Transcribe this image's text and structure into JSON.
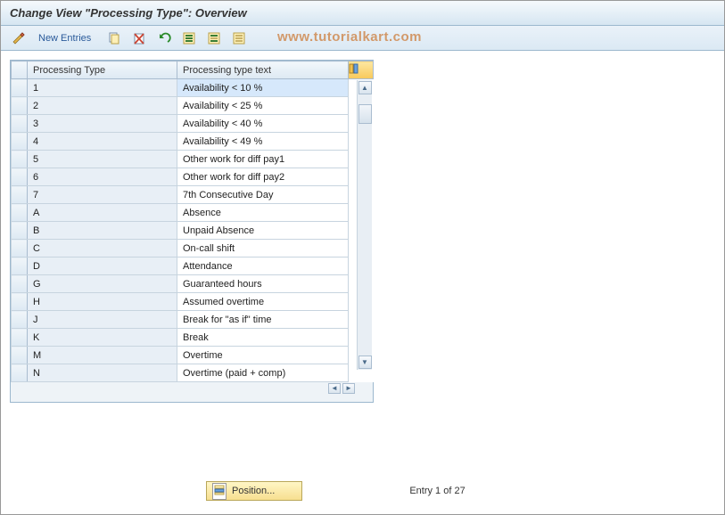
{
  "window": {
    "title": "Change View \"Processing Type\": Overview"
  },
  "toolbar": {
    "new_entries_label": "New Entries"
  },
  "watermark": "www.tutorialkart.com",
  "table": {
    "headers": {
      "type": "Processing Type",
      "text": "Processing type text"
    },
    "rows": [
      {
        "type": "1",
        "text": "Availability < 10 %"
      },
      {
        "type": "2",
        "text": "Availability < 25 %"
      },
      {
        "type": "3",
        "text": "Availability < 40 %"
      },
      {
        "type": "4",
        "text": "Availability < 49 %"
      },
      {
        "type": "5",
        "text": "Other work for diff pay1"
      },
      {
        "type": "6",
        "text": "Other work for diff pay2"
      },
      {
        "type": "7",
        "text": "7th Consecutive Day"
      },
      {
        "type": "A",
        "text": "Absence"
      },
      {
        "type": "B",
        "text": "Unpaid Absence"
      },
      {
        "type": "C",
        "text": "On-call shift"
      },
      {
        "type": "D",
        "text": "Attendance"
      },
      {
        "type": "G",
        "text": "Guaranteed hours"
      },
      {
        "type": "H",
        "text": "Assumed overtime"
      },
      {
        "type": "J",
        "text": "Break for \"as if\" time"
      },
      {
        "type": "K",
        "text": "Break"
      },
      {
        "type": "M",
        "text": "Overtime"
      },
      {
        "type": "N",
        "text": "Overtime (paid + comp)"
      }
    ]
  },
  "footer": {
    "position_label": "Position...",
    "entry_status": "Entry 1 of 27"
  }
}
